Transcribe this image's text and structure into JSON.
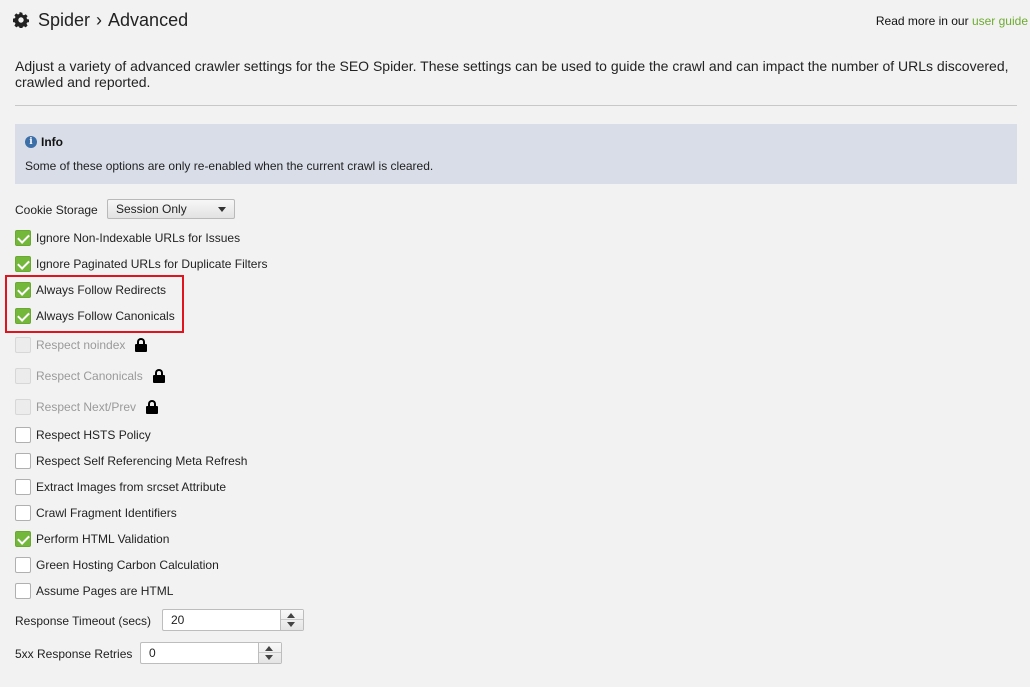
{
  "header": {
    "icon": "gear-icon",
    "section": "Spider",
    "separator": "›",
    "title": "Advanced",
    "read_more_prefix": "Read more in our",
    "read_more_link": "user guide",
    "link_color": "#6dab2f"
  },
  "description": "Adjust a variety of advanced crawler settings for the SEO Spider. These settings can be used to guide the crawl and can impact the number of URLs discovered, crawled and reported.",
  "info": {
    "icon": "info-icon",
    "title": "Info",
    "text": "Some of these options are only re-enabled when the current crawl is cleared."
  },
  "cookie_storage": {
    "label": "Cookie Storage",
    "value": "Session Only"
  },
  "options": [
    {
      "label": "Ignore Non-Indexable URLs for Issues",
      "checked": true,
      "disabled": false
    },
    {
      "label": "Ignore Paginated URLs for Duplicate Filters",
      "checked": true,
      "disabled": false
    },
    {
      "label": "Always Follow Redirects",
      "checked": true,
      "disabled": false
    },
    {
      "label": "Always Follow Canonicals",
      "checked": true,
      "disabled": false
    },
    {
      "label": "Respect noindex",
      "checked": false,
      "disabled": true,
      "locked": true
    },
    {
      "label": "Respect Canonicals",
      "checked": false,
      "disabled": true,
      "locked": true
    },
    {
      "label": "Respect Next/Prev",
      "checked": false,
      "disabled": true,
      "locked": true
    },
    {
      "label": "Respect HSTS Policy",
      "checked": false,
      "disabled": false
    },
    {
      "label": "Respect Self Referencing Meta Refresh",
      "checked": false,
      "disabled": false
    },
    {
      "label": "Extract Images from srcset Attribute",
      "checked": false,
      "disabled": false
    },
    {
      "label": "Crawl Fragment Identifiers",
      "checked": false,
      "disabled": false
    },
    {
      "label": "Perform HTML Validation",
      "checked": true,
      "disabled": false
    },
    {
      "label": "Green Hosting Carbon Calculation",
      "checked": false,
      "disabled": false
    },
    {
      "label": "Assume Pages are HTML",
      "checked": false,
      "disabled": false
    }
  ],
  "response_timeout": {
    "label": "Response Timeout (secs)",
    "value": "20"
  },
  "retries": {
    "label": "5xx Response Retries",
    "value": "0"
  },
  "colors": {
    "checked": "#74b83b",
    "highlight_border": "#e0141e",
    "info_bg": "#d8dde8"
  }
}
